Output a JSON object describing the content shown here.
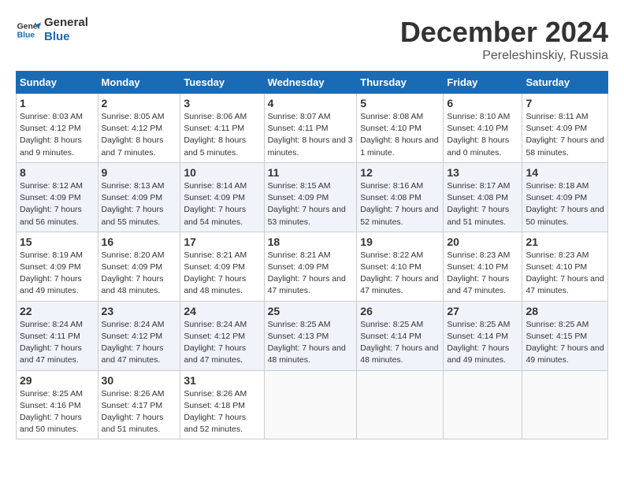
{
  "header": {
    "logo_line1": "General",
    "logo_line2": "Blue",
    "title": "December 2024",
    "subtitle": "Pereleshinskiy, Russia"
  },
  "weekdays": [
    "Sunday",
    "Monday",
    "Tuesday",
    "Wednesday",
    "Thursday",
    "Friday",
    "Saturday"
  ],
  "weeks": [
    [
      {
        "day": "1",
        "sunrise": "8:03 AM",
        "sunset": "4:12 PM",
        "daylight": "8 hours and 9 minutes."
      },
      {
        "day": "2",
        "sunrise": "8:05 AM",
        "sunset": "4:12 PM",
        "daylight": "8 hours and 7 minutes."
      },
      {
        "day": "3",
        "sunrise": "8:06 AM",
        "sunset": "4:11 PM",
        "daylight": "8 hours and 5 minutes."
      },
      {
        "day": "4",
        "sunrise": "8:07 AM",
        "sunset": "4:11 PM",
        "daylight": "8 hours and 3 minutes."
      },
      {
        "day": "5",
        "sunrise": "8:08 AM",
        "sunset": "4:10 PM",
        "daylight": "8 hours and 1 minute."
      },
      {
        "day": "6",
        "sunrise": "8:10 AM",
        "sunset": "4:10 PM",
        "daylight": "8 hours and 0 minutes."
      },
      {
        "day": "7",
        "sunrise": "8:11 AM",
        "sunset": "4:09 PM",
        "daylight": "7 hours and 58 minutes."
      }
    ],
    [
      {
        "day": "8",
        "sunrise": "8:12 AM",
        "sunset": "4:09 PM",
        "daylight": "7 hours and 56 minutes."
      },
      {
        "day": "9",
        "sunrise": "8:13 AM",
        "sunset": "4:09 PM",
        "daylight": "7 hours and 55 minutes."
      },
      {
        "day": "10",
        "sunrise": "8:14 AM",
        "sunset": "4:09 PM",
        "daylight": "7 hours and 54 minutes."
      },
      {
        "day": "11",
        "sunrise": "8:15 AM",
        "sunset": "4:09 PM",
        "daylight": "7 hours and 53 minutes."
      },
      {
        "day": "12",
        "sunrise": "8:16 AM",
        "sunset": "4:08 PM",
        "daylight": "7 hours and 52 minutes."
      },
      {
        "day": "13",
        "sunrise": "8:17 AM",
        "sunset": "4:08 PM",
        "daylight": "7 hours and 51 minutes."
      },
      {
        "day": "14",
        "sunrise": "8:18 AM",
        "sunset": "4:09 PM",
        "daylight": "7 hours and 50 minutes."
      }
    ],
    [
      {
        "day": "15",
        "sunrise": "8:19 AM",
        "sunset": "4:09 PM",
        "daylight": "7 hours and 49 minutes."
      },
      {
        "day": "16",
        "sunrise": "8:20 AM",
        "sunset": "4:09 PM",
        "daylight": "7 hours and 48 minutes."
      },
      {
        "day": "17",
        "sunrise": "8:21 AM",
        "sunset": "4:09 PM",
        "daylight": "7 hours and 48 minutes."
      },
      {
        "day": "18",
        "sunrise": "8:21 AM",
        "sunset": "4:09 PM",
        "daylight": "7 hours and 47 minutes."
      },
      {
        "day": "19",
        "sunrise": "8:22 AM",
        "sunset": "4:10 PM",
        "daylight": "7 hours and 47 minutes."
      },
      {
        "day": "20",
        "sunrise": "8:23 AM",
        "sunset": "4:10 PM",
        "daylight": "7 hours and 47 minutes."
      },
      {
        "day": "21",
        "sunrise": "8:23 AM",
        "sunset": "4:10 PM",
        "daylight": "7 hours and 47 minutes."
      }
    ],
    [
      {
        "day": "22",
        "sunrise": "8:24 AM",
        "sunset": "4:11 PM",
        "daylight": "7 hours and 47 minutes."
      },
      {
        "day": "23",
        "sunrise": "8:24 AM",
        "sunset": "4:12 PM",
        "daylight": "7 hours and 47 minutes."
      },
      {
        "day": "24",
        "sunrise": "8:24 AM",
        "sunset": "4:12 PM",
        "daylight": "7 hours and 47 minutes."
      },
      {
        "day": "25",
        "sunrise": "8:25 AM",
        "sunset": "4:13 PM",
        "daylight": "7 hours and 48 minutes."
      },
      {
        "day": "26",
        "sunrise": "8:25 AM",
        "sunset": "4:14 PM",
        "daylight": "7 hours and 48 minutes."
      },
      {
        "day": "27",
        "sunrise": "8:25 AM",
        "sunset": "4:14 PM",
        "daylight": "7 hours and 49 minutes."
      },
      {
        "day": "28",
        "sunrise": "8:25 AM",
        "sunset": "4:15 PM",
        "daylight": "7 hours and 49 minutes."
      }
    ],
    [
      {
        "day": "29",
        "sunrise": "8:25 AM",
        "sunset": "4:16 PM",
        "daylight": "7 hours and 50 minutes."
      },
      {
        "day": "30",
        "sunrise": "8:26 AM",
        "sunset": "4:17 PM",
        "daylight": "7 hours and 51 minutes."
      },
      {
        "day": "31",
        "sunrise": "8:26 AM",
        "sunset": "4:18 PM",
        "daylight": "7 hours and 52 minutes."
      },
      null,
      null,
      null,
      null
    ]
  ]
}
